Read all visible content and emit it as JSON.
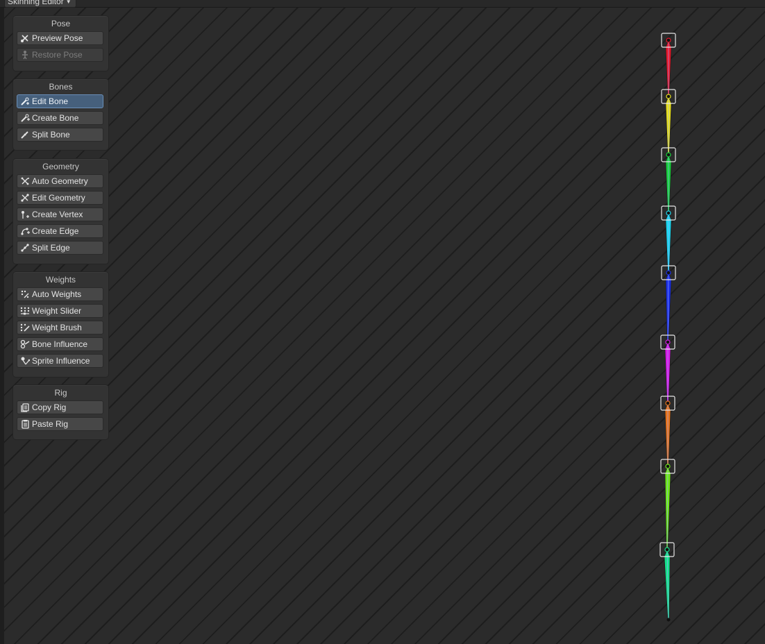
{
  "window": {
    "mode_label": "Skinning Editor"
  },
  "panels": {
    "pose": {
      "title": "Pose",
      "buttons": [
        {
          "label": "Preview Pose",
          "icon": "preview-pose-icon",
          "state": "normal"
        },
        {
          "label": "Restore Pose",
          "icon": "restore-pose-icon",
          "state": "disabled"
        }
      ]
    },
    "bones": {
      "title": "Bones",
      "buttons": [
        {
          "label": "Edit Bone",
          "icon": "edit-bone-icon",
          "state": "active"
        },
        {
          "label": "Create Bone",
          "icon": "create-bone-icon",
          "state": "normal"
        },
        {
          "label": "Split Bone",
          "icon": "split-bone-icon",
          "state": "normal"
        }
      ]
    },
    "geometry": {
      "title": "Geometry",
      "buttons": [
        {
          "label": "Auto Geometry",
          "icon": "auto-geometry-icon",
          "state": "normal"
        },
        {
          "label": "Edit Geometry",
          "icon": "edit-geometry-icon",
          "state": "normal"
        },
        {
          "label": "Create Vertex",
          "icon": "create-vertex-icon",
          "state": "normal"
        },
        {
          "label": "Create Edge",
          "icon": "create-edge-icon",
          "state": "normal"
        },
        {
          "label": "Split Edge",
          "icon": "split-edge-icon",
          "state": "normal"
        }
      ]
    },
    "weights": {
      "title": "Weights",
      "buttons": [
        {
          "label": "Auto Weights",
          "icon": "auto-weights-icon",
          "state": "normal"
        },
        {
          "label": "Weight Slider",
          "icon": "weight-slider-icon",
          "state": "normal"
        },
        {
          "label": "Weight Brush",
          "icon": "weight-brush-icon",
          "state": "normal"
        },
        {
          "label": "Bone Influence",
          "icon": "bone-influence-icon",
          "state": "normal"
        },
        {
          "label": "Sprite Influence",
          "icon": "sprite-influence-icon",
          "state": "normal"
        }
      ]
    },
    "rig": {
      "title": "Rig",
      "buttons": [
        {
          "label": "Copy Rig",
          "icon": "copy-rig-icon",
          "state": "normal"
        },
        {
          "label": "Paste Rig",
          "icon": "paste-rig-icon",
          "state": "normal"
        }
      ]
    }
  },
  "skeleton": {
    "bone_colors": [
      "#e8172a",
      "#e8e01a",
      "#17d13a",
      "#1ad7f0",
      "#1a2fe6",
      "#d81ae6",
      "#e8741a",
      "#6ee61a",
      "#16e08a"
    ]
  },
  "colors": {
    "accent": "#46607c",
    "canvas": "#2b2b2b",
    "panel": "#333333"
  }
}
